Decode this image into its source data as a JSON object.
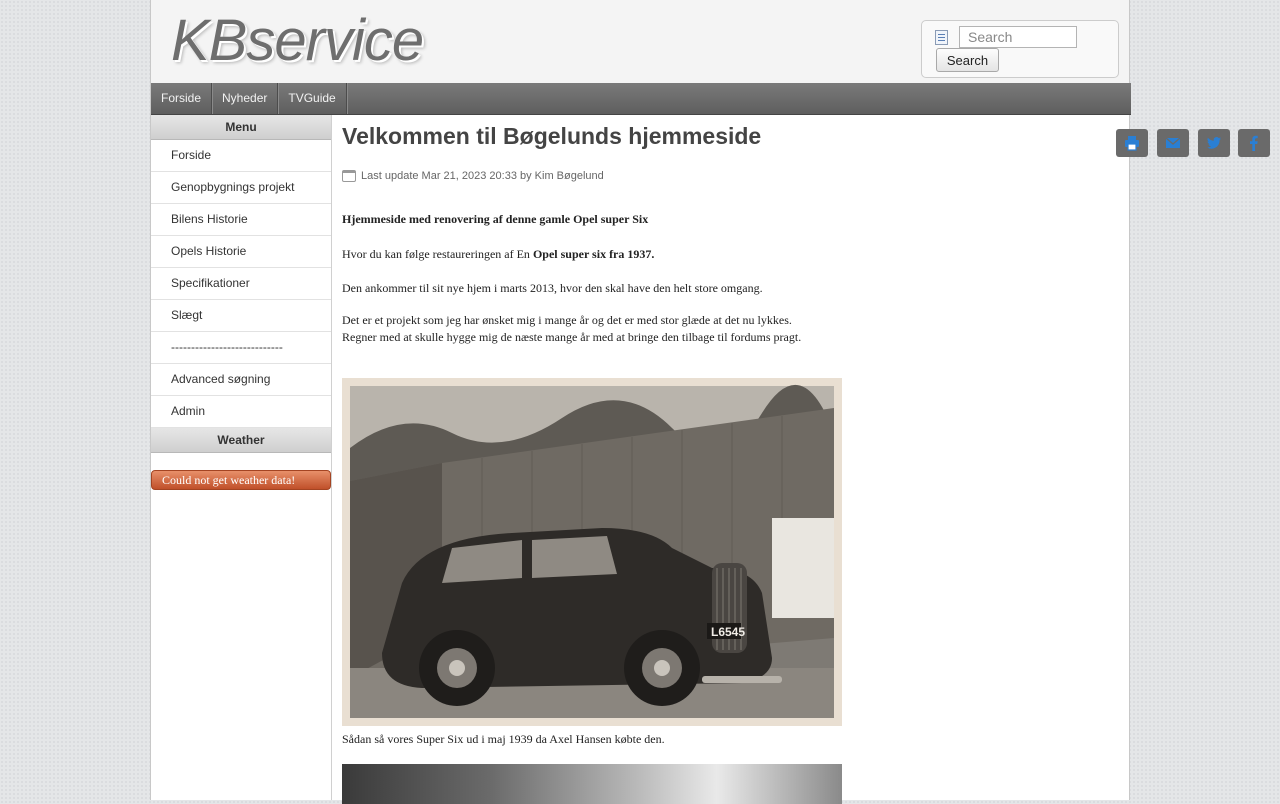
{
  "header": {
    "logo_text": "KBservice",
    "search": {
      "placeholder": "Search",
      "button_label": "Search"
    }
  },
  "nav": {
    "items": [
      "Forside",
      "Nyheder",
      "TVGuide"
    ]
  },
  "sidebar": {
    "menu_title": "Menu",
    "menu_items": [
      "Forside",
      "Genopbygnings projekt",
      "Bilens Historie",
      "Opels Historie",
      "Specifikationer",
      "Slægt",
      "----------------------------",
      "Advanced søgning",
      "Admin"
    ],
    "weather_title": "Weather",
    "weather_error": "Could not get weather data!"
  },
  "article": {
    "title": "Velkommen til Bøgelunds hjemmeside",
    "share_icons": [
      "print-icon",
      "envelope-icon",
      "twitter-icon",
      "facebook-icon"
    ],
    "meta": "Last update Mar 21, 2023 20:33 by Kim Bøgelund",
    "intro_bold": "Hjemmeside med renovering af denne gamle Opel super Six",
    "follow_prefix": "Hvor du kan følge restaureringen af En ",
    "follow_bold": "Opel super six fra 1937.",
    "p_arrival": "Den ankommer til sit nye hjem i marts 2013, hvor den skal have den helt store omgang.",
    "p_project_1": "Det er et projekt som jeg har ønsket mig i mange år og det er med stor glæde at det nu lykkes.",
    "p_project_2": "Regner med at skulle hygge mig de næste mange år med at bringe den tilbage til fordums pragt.",
    "license_plate": "L6545",
    "caption": "Sådan så vores Super Six ud i maj 1939 da Axel Hansen købte den."
  },
  "colors": {
    "nav_bg": "#6b6b6b",
    "share_bg": "#6a6a6a",
    "weather_error_bg": "#d8693f"
  }
}
